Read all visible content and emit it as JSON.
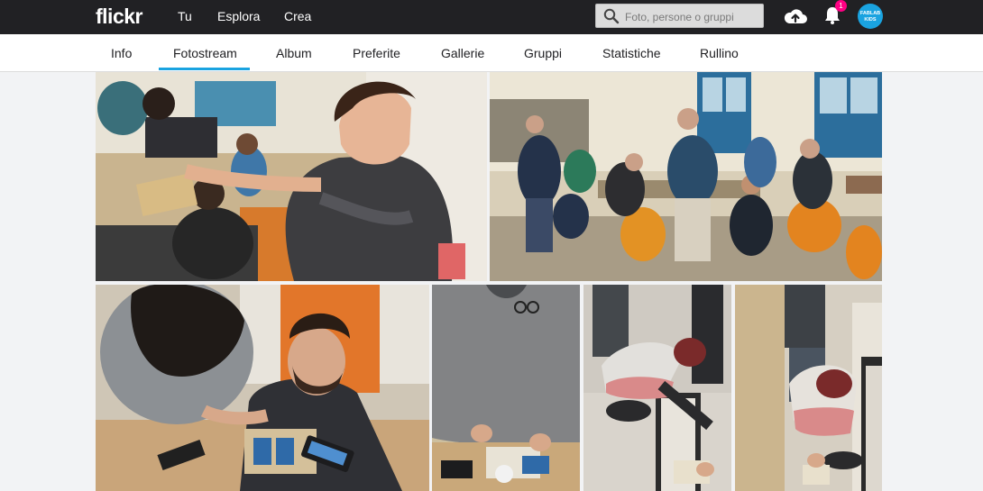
{
  "header": {
    "logo": "flickr",
    "nav": [
      "Tu",
      "Esplora",
      "Crea"
    ],
    "search_placeholder": "Foto, persone o gruppi",
    "notification_count": "1",
    "avatar_text_top": "FABLAB",
    "avatar_text_bottom": "KIDS",
    "icons": [
      "search-icon",
      "upload-cloud-icon",
      "bell-icon"
    ]
  },
  "tabs": [
    {
      "label": "Info",
      "active": false
    },
    {
      "label": "Fotostream",
      "active": true
    },
    {
      "label": "Album",
      "active": false
    },
    {
      "label": "Preferite",
      "active": false
    },
    {
      "label": "Gallerie",
      "active": false
    },
    {
      "label": "Gruppi",
      "active": false
    },
    {
      "label": "Statistiche",
      "active": false
    },
    {
      "label": "Rullino",
      "active": false
    }
  ],
  "colors": {
    "topbar": "#212124",
    "accent": "#1aa3e0",
    "badge": "#ff0084",
    "background": "#f2f3f5"
  },
  "photos": [
    {
      "subject": "boy-holding-robot-kit"
    },
    {
      "subject": "kids-in-lab-room"
    },
    {
      "subject": "young-man-wiring-arduino"
    },
    {
      "subject": "hands-assembling-robot"
    },
    {
      "subject": "girl-testing-robot-on-floor"
    },
    {
      "subject": "girl-kneeling-with-robot"
    }
  ]
}
